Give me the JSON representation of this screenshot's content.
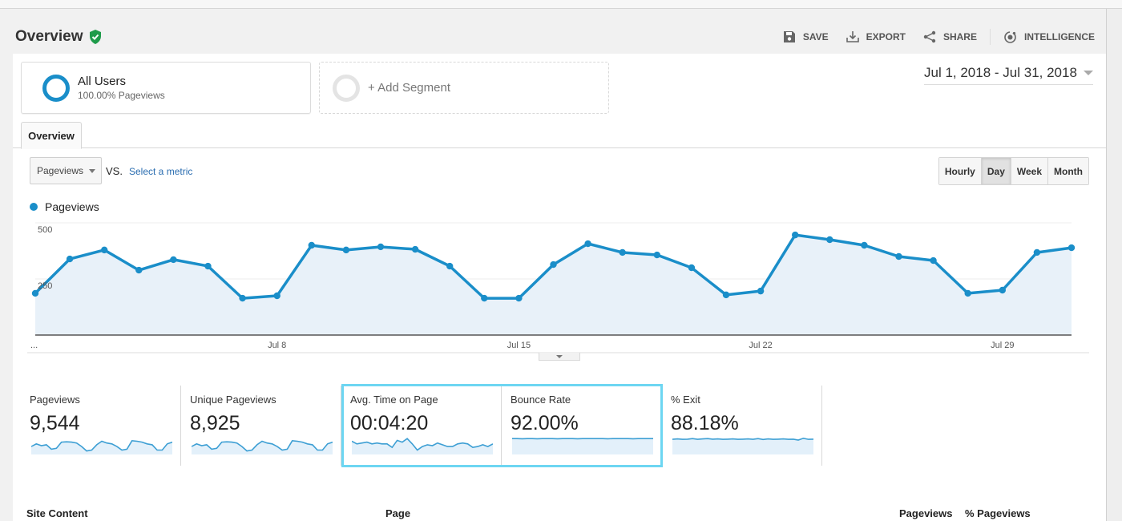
{
  "header": {
    "title": "Overview",
    "verified_icon": "shield-check-icon",
    "toolbar": [
      {
        "label": "SAVE",
        "icon": "save-icon"
      },
      {
        "label": "EXPORT",
        "icon": "download-icon"
      },
      {
        "label": "SHARE",
        "icon": "share-icon"
      },
      {
        "label": "INTELLIGENCE",
        "icon": "intelligence-icon"
      }
    ]
  },
  "segments": {
    "active": {
      "name": "All Users",
      "subtitle": "100.00% Pageviews"
    },
    "add_label": "+ Add Segment"
  },
  "date_range": "Jul 1, 2018 - Jul 31, 2018",
  "tabs": [
    {
      "label": "Overview",
      "active": true
    }
  ],
  "controls": {
    "metric_selected": "Pageviews",
    "vs_label": "VS.",
    "select_metric_label": "Select a metric",
    "granularity": [
      {
        "label": "Hourly",
        "active": false
      },
      {
        "label": "Day",
        "active": true
      },
      {
        "label": "Week",
        "active": false
      },
      {
        "label": "Month",
        "active": false
      }
    ]
  },
  "colors": {
    "series": "#1a8ec9",
    "fill": "#e8f1f9",
    "highlight": "#6dd6f2"
  },
  "chart_data": {
    "type": "area",
    "title": "",
    "legend": [
      {
        "name": "Pageviews",
        "placement": "top-left"
      }
    ],
    "xlabel": "",
    "ylabel": "",
    "ylim": [
      0,
      500
    ],
    "yticks": [
      250,
      500
    ],
    "xtick_labels": [
      {
        "day": 1,
        "label": "..."
      },
      {
        "day": 8,
        "label": "Jul 8"
      },
      {
        "day": 15,
        "label": "Jul 15"
      },
      {
        "day": 22,
        "label": "Jul 22"
      },
      {
        "day": 29,
        "label": "Jul 29"
      }
    ],
    "grid": true,
    "x": [
      1,
      2,
      3,
      4,
      5,
      6,
      7,
      8,
      9,
      10,
      11,
      12,
      13,
      14,
      15,
      16,
      17,
      18,
      19,
      20,
      21,
      22,
      23,
      24,
      25,
      26,
      27,
      28,
      29,
      30,
      31
    ],
    "series": [
      {
        "name": "Pageviews",
        "values": [
          186,
          339,
          379,
          289,
          336,
          307,
          164,
          175,
          400,
          379,
          393,
          382,
          307,
          164,
          164,
          314,
          407,
          368,
          357,
          300,
          179,
          196,
          446,
          425,
          400,
          350,
          332,
          186,
          200,
          368,
          389
        ]
      }
    ]
  },
  "scorecards": [
    {
      "label": "Pageviews",
      "value": "9,544",
      "spark": [
        0.45,
        0.6,
        0.5,
        0.55,
        0.3,
        0.35,
        0.7,
        0.72,
        0.7,
        0.65,
        0.45,
        0.2,
        0.25,
        0.55,
        0.75,
        0.65,
        0.6,
        0.45,
        0.25,
        0.3,
        0.78,
        0.75,
        0.7,
        0.6,
        0.55,
        0.25,
        0.25,
        0.6,
        0.7
      ]
    },
    {
      "label": "Unique Pageviews",
      "value": "8,925",
      "spark": [
        0.45,
        0.6,
        0.5,
        0.55,
        0.3,
        0.35,
        0.7,
        0.72,
        0.7,
        0.65,
        0.45,
        0.2,
        0.25,
        0.55,
        0.75,
        0.65,
        0.6,
        0.45,
        0.25,
        0.3,
        0.78,
        0.75,
        0.7,
        0.6,
        0.55,
        0.25,
        0.25,
        0.6,
        0.7
      ]
    },
    {
      "label": "Avg. Time on Page",
      "value": "00:04:20",
      "spark": [
        0.75,
        0.6,
        0.65,
        0.7,
        0.6,
        0.65,
        0.6,
        0.6,
        0.4,
        0.8,
        0.7,
        0.9,
        0.6,
        0.25,
        0.45,
        0.55,
        0.5,
        0.65,
        0.55,
        0.45,
        0.45,
        0.6,
        0.65,
        0.6,
        0.4,
        0.45,
        0.55,
        0.45,
        0.6
      ]
    },
    {
      "label": "Bounce Rate",
      "value": "92.00%",
      "spark": [
        0.9,
        0.9,
        0.89,
        0.9,
        0.9,
        0.89,
        0.9,
        0.9,
        0.9,
        0.89,
        0.9,
        0.9,
        0.9,
        0.89,
        0.9,
        0.9,
        0.9,
        0.9,
        0.9,
        0.89,
        0.9,
        0.9,
        0.9,
        0.9,
        0.89,
        0.9,
        0.9,
        0.9,
        0.9
      ]
    },
    {
      "label": "% Exit",
      "value": "88.18%",
      "spark": [
        0.86,
        0.88,
        0.86,
        0.87,
        0.9,
        0.86,
        0.88,
        0.9,
        0.87,
        0.88,
        0.86,
        0.87,
        0.88,
        0.86,
        0.87,
        0.88,
        0.86,
        0.9,
        0.85,
        0.88,
        0.86,
        0.87,
        0.88,
        0.86,
        0.87,
        0.82,
        0.92,
        0.86,
        0.87
      ]
    }
  ],
  "table": {
    "headers": [
      "Site Content",
      "Page",
      "Pageviews",
      "% Pageviews"
    ]
  }
}
